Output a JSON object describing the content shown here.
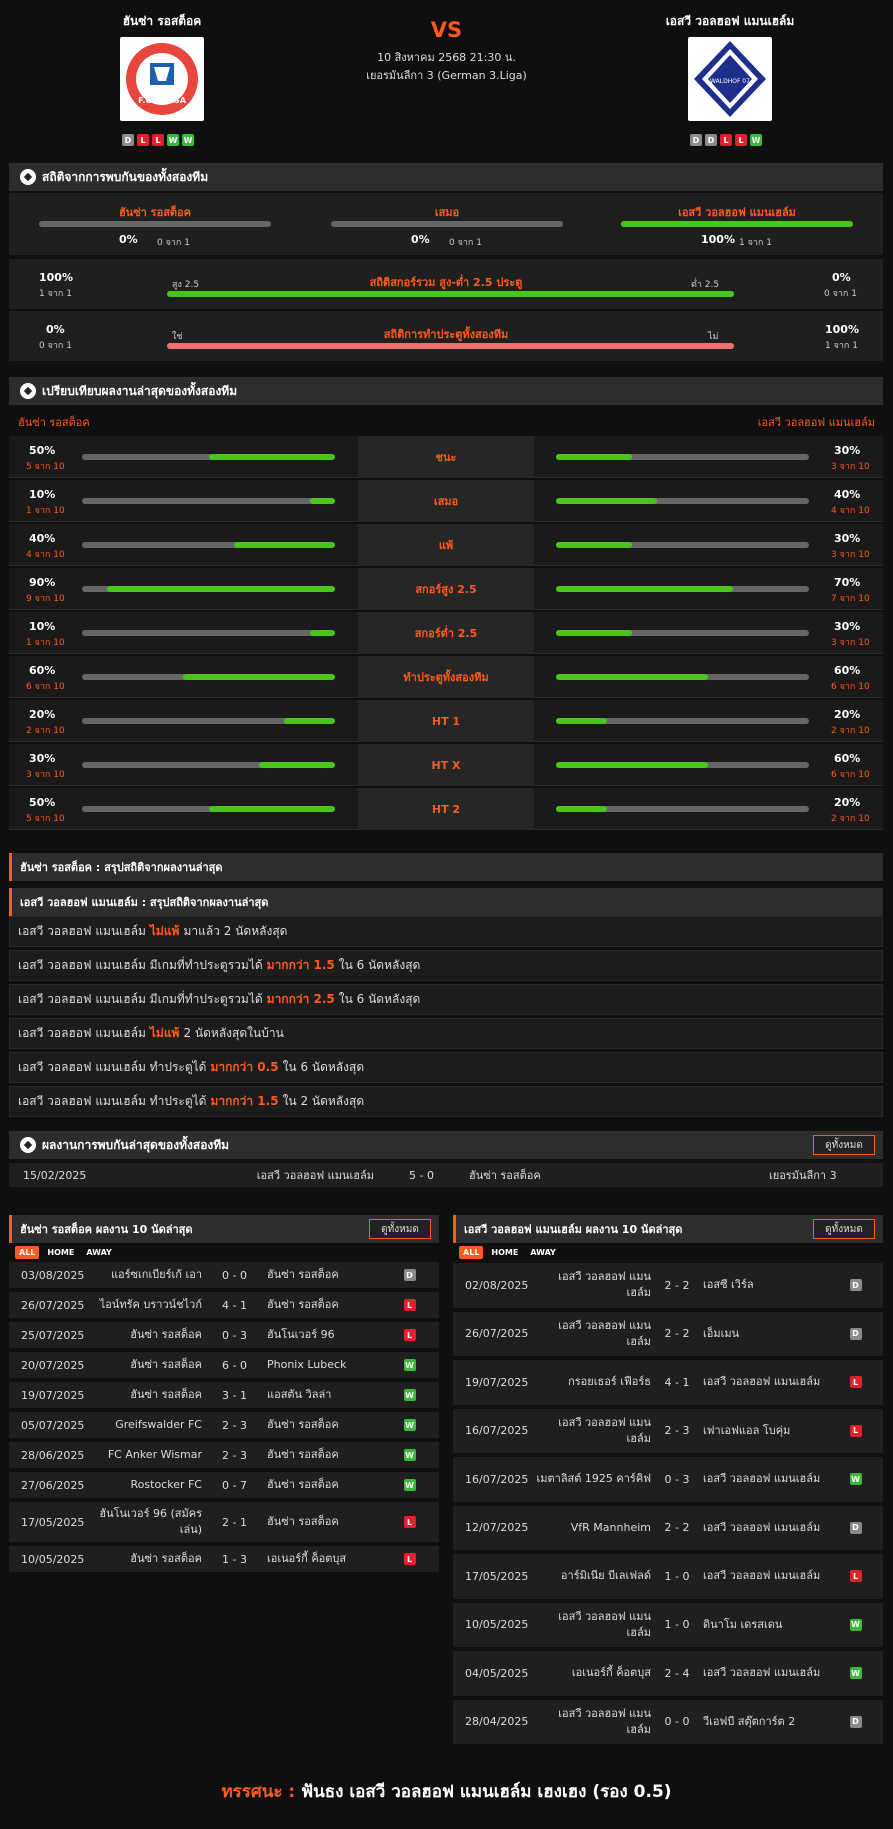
{
  "header": {
    "home_name": "ฮันซ่า รอสต็อค",
    "away_name": "เอสวี วอลฮอฟ แมนเฮล์ม",
    "vs": "VS",
    "date": "10 สิงหาคม 2568 21:30 น.",
    "league": "เยอรมันลีกา 3 (German 3.Liga)",
    "home_form": [
      "D",
      "L",
      "L",
      "W",
      "W"
    ],
    "away_form": [
      "D",
      "D",
      "L",
      "L",
      "W"
    ],
    "home_logo_text": "F.C.HANSA",
    "away_logo_text": "WALDHOF 07"
  },
  "h2h_stats": {
    "title": "สถิติจากการพบกันของทั้งสองทีม",
    "cols": [
      {
        "label": "ฮันซ่า รอสต็อค",
        "pct": "0%",
        "count": "0 จาก 1",
        "fill": 0
      },
      {
        "label": "เสมอ",
        "pct": "0%",
        "count": "0 จาก 1",
        "fill": 0
      },
      {
        "label": "เอสวี วอลฮอฟ แมนเฮล์ม",
        "pct": "100%",
        "count": "1 จาก 1",
        "fill": 1
      }
    ],
    "ou": {
      "left_pct": "100%",
      "left_count": "1 จาก 1",
      "left_label": "สูง 2.5",
      "title": "สถิติสกอร์รวม สูง-ต่ำ 2.5 ประตู",
      "right_label": "ต่ำ 2.5",
      "right_pct": "0%",
      "right_count": "0 จาก 1",
      "fill": 1
    },
    "btts": {
      "left_pct": "0%",
      "left_count": "0 จาก 1",
      "left_label": "ใช่",
      "title": "สถิติการทำประตูทั้งสองทีม",
      "right_label": "ไม่",
      "right_pct": "100%",
      "right_count": "1 จาก 1",
      "fill": 1
    }
  },
  "compare": {
    "title": "เปรียบเทียบผลงานล่าสุดของทั้งสองทีม",
    "home": "ฮันซ่า รอสต็อค",
    "away": "เอสวี วอลฮอฟ แมนเฮล์ม",
    "rows": [
      {
        "label": "ชนะ",
        "hp": "50%",
        "hc": "5 จาก 10",
        "hv": 0.5,
        "ap": "30%",
        "ac": "3 จาก 10",
        "av": 0.3
      },
      {
        "label": "เสมอ",
        "hp": "10%",
        "hc": "1 จาก 10",
        "hv": 0.1,
        "ap": "40%",
        "ac": "4 จาก 10",
        "av": 0.4
      },
      {
        "label": "แพ้",
        "hp": "40%",
        "hc": "4 จาก 10",
        "hv": 0.4,
        "ap": "30%",
        "ac": "3 จาก 10",
        "av": 0.3
      },
      {
        "label": "สกอร์สูง 2.5",
        "hp": "90%",
        "hc": "9 จาก 10",
        "hv": 0.9,
        "ap": "70%",
        "ac": "7 จาก 10",
        "av": 0.7
      },
      {
        "label": "สกอร์ต่ำ 2.5",
        "hp": "10%",
        "hc": "1 จาก 10",
        "hv": 0.1,
        "ap": "30%",
        "ac": "3 จาก 10",
        "av": 0.3
      },
      {
        "label": "ทำประตูทั้งสองทีม",
        "hp": "60%",
        "hc": "6 จาก 10",
        "hv": 0.6,
        "ap": "60%",
        "ac": "6 จาก 10",
        "av": 0.6
      },
      {
        "label": "HT 1",
        "hp": "20%",
        "hc": "2 จาก 10",
        "hv": 0.2,
        "ap": "20%",
        "ac": "2 จาก 10",
        "av": 0.2
      },
      {
        "label": "HT X",
        "hp": "30%",
        "hc": "3 จาก 10",
        "hv": 0.3,
        "ap": "60%",
        "ac": "6 จาก 10",
        "av": 0.6
      },
      {
        "label": "HT 2",
        "hp": "50%",
        "hc": "5 จาก 10",
        "hv": 0.5,
        "ap": "20%",
        "ac": "2 จาก 10",
        "av": 0.2
      }
    ]
  },
  "summary": {
    "home_title": "ฮันซ่า รอสต็อค : สรุปสถิติจากผลงานล่าสุด",
    "away_title": "เอสวี วอลฮอฟ แมนเฮล์ม : สรุปสถิติจากผลงานล่าสุด",
    "notes": [
      {
        "pre": "เอสวี วอลฮอฟ แมนเฮล์ม",
        "hl": "ไม่แพ้",
        "post": "มาแล้ว 2 นัดหลังสุด"
      },
      {
        "pre": "เอสวี วอลฮอฟ แมนเฮล์ม  มีเกมที่ทำประตูรวมได้",
        "hl": "มากกว่า  1.5",
        "post": "ใน 6 นัดหลังสุด"
      },
      {
        "pre": "เอสวี วอลฮอฟ แมนเฮล์ม  มีเกมที่ทำประตูรวมได้",
        "hl": "มากกว่า  2.5",
        "post": "ใน 6 นัดหลังสุด"
      },
      {
        "pre": "เอสวี วอลฮอฟ แมนเฮล์ม",
        "hl": "ไม่แพ้",
        "post": "2  นัดหลังสุดในบ้าน"
      },
      {
        "pre": "เอสวี วอลฮอฟ แมนเฮล์ม  ทำประตูได้",
        "hl": "มากกว่า  0.5",
        "post": "ใน 6 นัดหลังสุด"
      },
      {
        "pre": "เอสวี วอลฮอฟ แมนเฮล์ม  ทำประตูได้",
        "hl": "มากกว่า  1.5",
        "post": "ใน 2 นัดหลังสุด"
      }
    ]
  },
  "h2h": {
    "title": "ผลงานการพบกันล่าสุดของทั้งสองทีม",
    "view_all": "ดูทั้งหมด",
    "matches": [
      {
        "date": "15/02/2025",
        "home": "เอสวี วอลฮอฟ แมนเฮล์ม",
        "score": "5 - 0",
        "away": "ฮันซ่า รอสต็อค",
        "league": "เยอรมันลีกา 3"
      }
    ]
  },
  "home_last": {
    "title": "ฮันซ่า รอสต็อค ผลงาน 10 นัดล่าสุด",
    "view_all": "ดูทั้งหมด",
    "tabs": [
      "ALL",
      "HOME",
      "AWAY"
    ],
    "matches": [
      {
        "date": "03/08/2025",
        "home": "แอร์ซเกเบียร์เก้ เอา",
        "score": "0 - 0",
        "away": "ฮันซ่า รอสต็อค",
        "res": "D"
      },
      {
        "date": "26/07/2025",
        "home": "ไอน์ทรัค บราวน์ชไวก์",
        "score": "4 - 1",
        "away": "ฮันซ่า รอสต็อค",
        "res": "L"
      },
      {
        "date": "25/07/2025",
        "home": "ฮันซ่า รอสต็อค",
        "score": "0 - 3",
        "away": "ฮันโนเวอร์ 96",
        "res": "L"
      },
      {
        "date": "20/07/2025",
        "home": "ฮันซ่า รอสต็อค",
        "score": "6 - 0",
        "away": "Phonix Lubeck",
        "res": "W"
      },
      {
        "date": "19/07/2025",
        "home": "ฮันซ่า รอสต็อค",
        "score": "3 - 1",
        "away": "แอสตัน วิลล่า",
        "res": "W"
      },
      {
        "date": "05/07/2025",
        "home": "Greifswalder FC",
        "score": "2 - 3",
        "away": "ฮันซ่า รอสต็อค",
        "res": "W"
      },
      {
        "date": "28/06/2025",
        "home": "FC Anker Wismar",
        "score": "2 - 3",
        "away": "ฮันซ่า รอสต็อค",
        "res": "W"
      },
      {
        "date": "27/06/2025",
        "home": "Rostocker FC",
        "score": "0 - 7",
        "away": "ฮันซ่า รอสต็อค",
        "res": "W"
      },
      {
        "date": "17/05/2025",
        "home": "ฮันโนเวอร์ 96 (สมัครเล่น)",
        "score": "2 - 1",
        "away": "ฮันซ่า รอสต็อค",
        "res": "L"
      },
      {
        "date": "10/05/2025",
        "home": "ฮันซ่า รอสต็อค",
        "score": "1 - 3",
        "away": "เอเนอร์กี้ ค็อตบุส",
        "res": "L"
      }
    ]
  },
  "away_last": {
    "title": "เอสวี วอลฮอฟ แมนเฮล์ม ผลงาน 10 นัดล่าสุด",
    "view_all": "ดูทั้งหมด",
    "tabs": [
      "ALL",
      "HOME",
      "AWAY"
    ],
    "matches": [
      {
        "date": "02/08/2025",
        "home": "เอสวี วอลฮอฟ แมนเฮล์ม",
        "score": "2 - 2",
        "away": "เอสซี เวิร์ล",
        "res": "D"
      },
      {
        "date": "26/07/2025",
        "home": "เอสวี วอลฮอฟ แมนเฮล์ม",
        "score": "2 - 2",
        "away": "เอ็มเมน",
        "res": "D"
      },
      {
        "date": "19/07/2025",
        "home": "กรอยเธอร์ เฟือร์ธ",
        "score": "4 - 1",
        "away": "เอสวี วอลฮอฟ แมนเฮล์ม",
        "res": "L"
      },
      {
        "date": "16/07/2025",
        "home": "เอสวี วอลฮอฟ แมนเฮล์ม",
        "score": "2 - 3",
        "away": "เฟาเอฟแอล โบคุ่ม",
        "res": "L"
      },
      {
        "date": "16/07/2025",
        "home": "เมตาลิสต์ 1925 คาร์คิฟ",
        "score": "0 - 3",
        "away": "เอสวี วอลฮอฟ แมนเฮล์ม",
        "res": "W"
      },
      {
        "date": "12/07/2025",
        "home": "VfR Mannheim",
        "score": "2 - 2",
        "away": "เอสวี วอลฮอฟ แมนเฮล์ม",
        "res": "D"
      },
      {
        "date": "17/05/2025",
        "home": "อาร์มิเนีย บีเลเฟลด์",
        "score": "1 - 0",
        "away": "เอสวี วอลฮอฟ แมนเฮล์ม",
        "res": "L"
      },
      {
        "date": "10/05/2025",
        "home": "เอสวี วอลฮอฟ แมนเฮล์ม",
        "score": "1 - 0",
        "away": "ดินาโม เดรสเดน",
        "res": "W"
      },
      {
        "date": "04/05/2025",
        "home": "เอเนอร์กี้ ค็อตบุส",
        "score": "2 - 4",
        "away": "เอสวี วอลฮอฟ แมนเฮล์ม",
        "res": "W"
      },
      {
        "date": "28/04/2025",
        "home": "เอสวี วอลฮอฟ แมนเฮล์ม",
        "score": "0 - 0",
        "away": "วีเอฟบี สตุ๊ตการ์ต 2",
        "res": "D"
      }
    ]
  },
  "prediction": {
    "label": "ทรรศนะ :",
    "text": "ฟันธง เอสวี วอลฮอฟ แมนเฮล์ม เฮงเฮง (รอง 0.5)"
  },
  "colors": {
    "accent": "#ff5a1f",
    "green": "#49c61e",
    "red": "#f07070"
  }
}
